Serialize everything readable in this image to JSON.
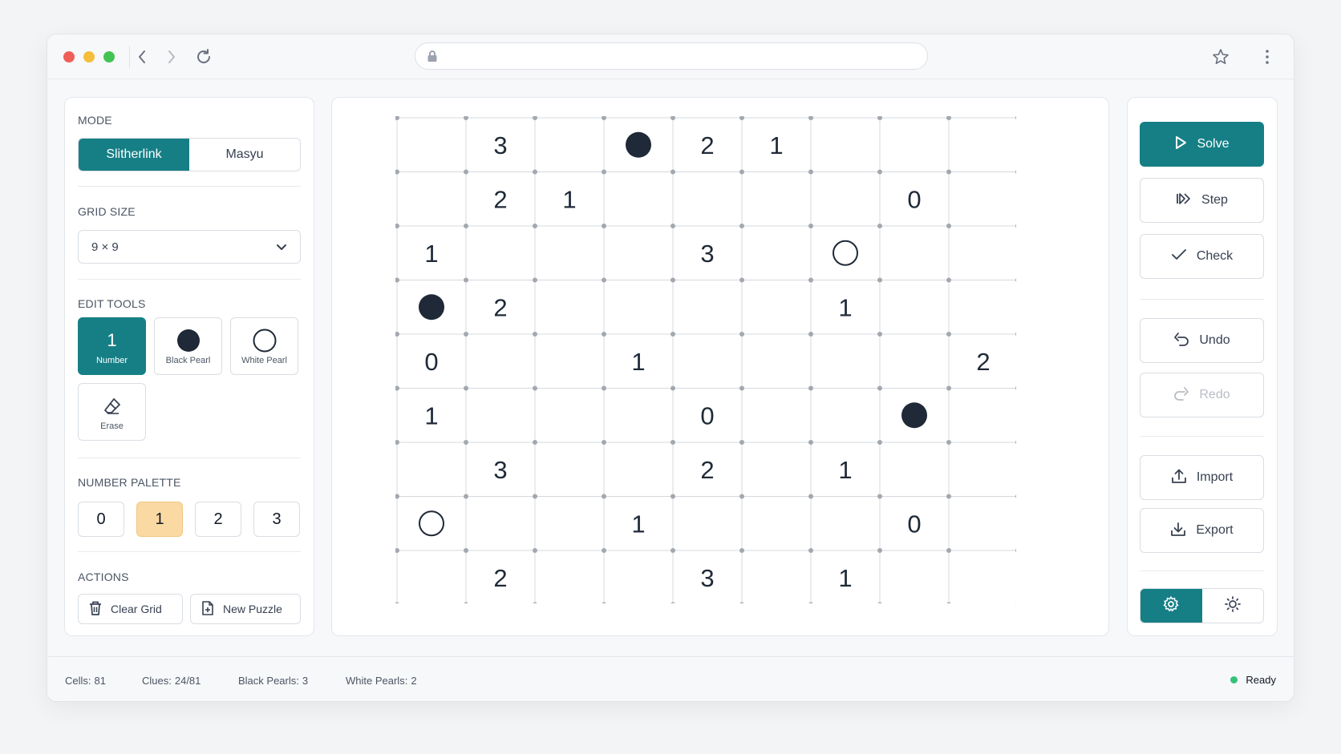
{
  "browser": {
    "url": ""
  },
  "left_panel": {
    "mode": {
      "label": "MODE",
      "options": [
        "Slitherlink",
        "Masyu"
      ],
      "selected": "Slitherlink"
    },
    "grid_size": {
      "label": "GRID SIZE",
      "value": "9 × 9"
    },
    "edit_tools": {
      "label": "EDIT TOOLS",
      "number_glyph": "1",
      "items": [
        "Number",
        "Black Pearl",
        "White Pearl",
        "Erase"
      ],
      "selected": "Number"
    },
    "number_palette": {
      "label": "NUMBER PALETTE",
      "values": [
        "0",
        "1",
        "2",
        "3"
      ],
      "selected": "1"
    },
    "actions": {
      "label": "ACTIONS",
      "clear": "Clear Grid",
      "new": "New Puzzle"
    }
  },
  "board": {
    "rows": 9,
    "cols": 9,
    "cells": [
      [
        "",
        "3",
        "",
        "B",
        "2",
        "1",
        "",
        "",
        ""
      ],
      [
        "",
        "2",
        "1",
        "",
        "",
        "",
        "",
        "0",
        ""
      ],
      [
        "1",
        "",
        "",
        "",
        "3",
        "",
        "W",
        "",
        ""
      ],
      [
        "B",
        "2",
        "",
        "",
        "",
        "",
        "1",
        "",
        ""
      ],
      [
        "0",
        "",
        "",
        "1",
        "",
        "",
        "",
        "",
        "2"
      ],
      [
        "1",
        "",
        "",
        "",
        "0",
        "",
        "",
        "B",
        ""
      ],
      [
        "",
        "3",
        "",
        "",
        "2",
        "",
        "1",
        "",
        ""
      ],
      [
        "W",
        "",
        "",
        "1",
        "",
        "",
        "",
        "0",
        ""
      ],
      [
        "",
        "2",
        "",
        "",
        "3",
        "",
        "1",
        "",
        ""
      ]
    ]
  },
  "right_panel": {
    "solve": "Solve",
    "step": "Step",
    "check": "Check",
    "undo": "Undo",
    "redo": "Redo",
    "import": "Import",
    "export": "Export",
    "toggle_icons": [
      "gear-icon",
      "sun-icon"
    ]
  },
  "status": {
    "cells_label": "Cells:",
    "cells": "81",
    "clues_label": "Clues:",
    "clues": "24/81",
    "black_label": "Black Pearls:",
    "black": "3",
    "white_label": "White Pearls:",
    "white": "2",
    "state": "Ready"
  },
  "colors": {
    "accent": "#167f86",
    "palette_selected": "#fbd9a3",
    "pearl": "#1f2937",
    "ready": "#34c17a"
  }
}
